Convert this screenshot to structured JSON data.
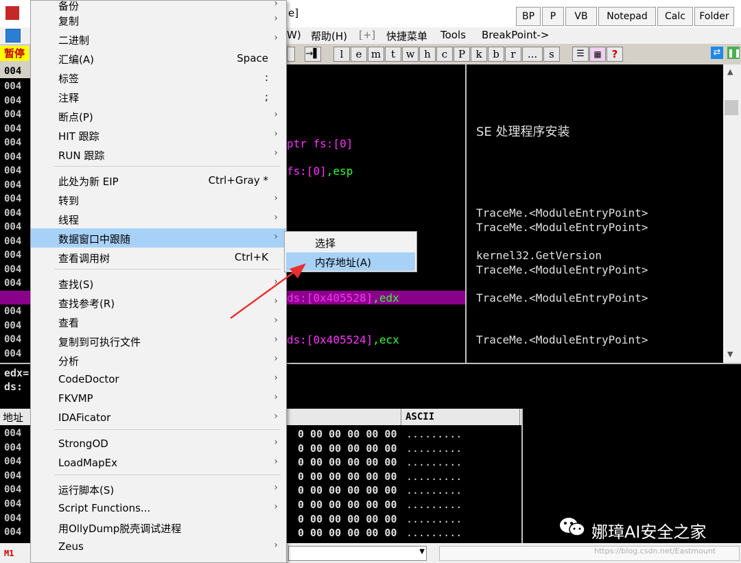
{
  "titlebar": {
    "app_title_fragment": "e]"
  },
  "quick_buttons": [
    "BP",
    "P",
    "VB",
    "Notepad",
    "Calc",
    "Folder"
  ],
  "menubar": {
    "items": [
      "W)",
      "帮助(H)",
      "[+]",
      "快捷菜单",
      "Tools",
      "BreakPoint->"
    ]
  },
  "toolbar": {
    "status": "暂停",
    "letters": [
      "l",
      "e",
      "m",
      "t",
      "w",
      "h",
      "c",
      "P",
      "k",
      "b",
      "r",
      "...",
      "s"
    ]
  },
  "disasm": {
    "addr_prefix": "004",
    "addr_header": "004",
    "code": [
      {
        "text": "ptr fs:[0]",
        "color": "#ff33ff"
      },
      {
        "text": "fs:[0],esp",
        "color": "#ff33ff",
        "green_part": ",esp"
      },
      {
        "text": "ds:[0x405528],edx",
        "color": "#ff33ff"
      },
      {
        "text": "ds:[0x405524],ecx",
        "color": "#ff33ff"
      }
    ],
    "comments": [
      "SE 处理程序安装",
      "TraceMe.<ModuleEntryPoint>",
      "TraceMe.<ModuleEntryPoint>",
      "kernel32.GetVersion",
      "TraceMe.<ModuleEntryPoint>",
      "TraceMe.<ModuleEntryPoint>",
      "TraceMe.<ModuleEntryPoint>"
    ],
    "highlight_color": "#8b008b"
  },
  "info": {
    "line1": "edx=",
    "line2": "ds:"
  },
  "dump": {
    "addr_header": "地址",
    "ascii_header": "ASCII",
    "hex_row": "0 00  00 00 00 00",
    "ascii_row": "........."
  },
  "statusbar": {
    "mode": "M1"
  },
  "watermark": {
    "text": "娜璋AI安全之家",
    "url": "https://blog.csdn.net/Eastmount"
  },
  "context_menu": {
    "items": [
      {
        "label": "备份",
        "arrow": true
      },
      {
        "label": "复制",
        "arrow": true
      },
      {
        "label": "二进制",
        "arrow": true
      },
      {
        "label": "汇编(A)",
        "shortcut": "Space"
      },
      {
        "label": "标签",
        "shortcut": ":"
      },
      {
        "label": "注释",
        "shortcut": ";"
      },
      {
        "label": "断点(P)",
        "arrow": true
      },
      {
        "label": "HIT 跟踪",
        "arrow": true
      },
      {
        "label": "RUN 跟踪",
        "arrow": true
      },
      {
        "label": "此处为新 EIP",
        "shortcut": "Ctrl+Gray *"
      },
      {
        "label": "转到",
        "arrow": true
      },
      {
        "label": "线程",
        "arrow": true
      },
      {
        "label": "数据窗口中跟随",
        "arrow": true
      },
      {
        "label": "查看调用树",
        "shortcut": "Ctrl+K"
      },
      {
        "label": "查找(S)",
        "arrow": true
      },
      {
        "label": "查找参考(R)",
        "arrow": true
      },
      {
        "label": "查看",
        "arrow": true
      },
      {
        "label": "复制到可执行文件",
        "arrow": true
      },
      {
        "label": "分析",
        "arrow": true
      },
      {
        "label": "CodeDoctor",
        "arrow": true
      },
      {
        "label": "FKVMP",
        "arrow": true
      },
      {
        "label": "IDAFicator",
        "arrow": true
      },
      {
        "label": "StrongOD",
        "arrow": true
      },
      {
        "label": "LoadMapEx",
        "arrow": true
      },
      {
        "label": "运行脚本(S)",
        "arrow": true
      },
      {
        "label": "Script Functions...",
        "arrow": true
      },
      {
        "label": "用OllyDump脱壳调试进程"
      },
      {
        "label": "Zeus",
        "arrow": true
      }
    ],
    "arrow_glyph": "›"
  },
  "submenu": {
    "items": [
      "选择",
      "内存地址(A)"
    ]
  },
  "colors": {
    "menu_highlight": "#a8d1f7",
    "code_magenta": "#ff33ff",
    "code_green": "#33ff33",
    "annotation_red": "#e83030"
  }
}
